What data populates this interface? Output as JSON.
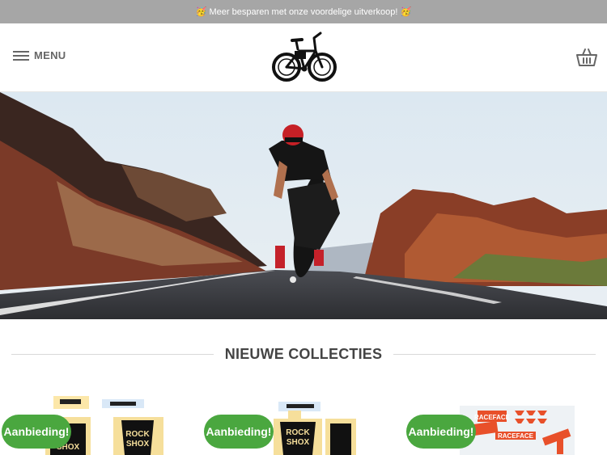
{
  "announcement": "🥳 Meer besparen met onze voordelige uitverkoop! 🥳",
  "header": {
    "menu_label": "MENU",
    "logo_icon": "bicycle-logo",
    "cart_icon": "basket-icon"
  },
  "hero": {
    "image": "road-cyclist-hero"
  },
  "collections": {
    "title": "NIEUWE COLLECTIES"
  },
  "products": [
    {
      "badge": "Aanbieding!",
      "image": "rockshox-decal-kit"
    },
    {
      "badge": "Aanbieding!",
      "image": "rockshox-decal-kit"
    },
    {
      "badge": "Aanbieding!",
      "image": "raceface-decal-kit"
    }
  ],
  "colors": {
    "topbar": "#a6a6a6",
    "badge": "#4aa73f",
    "title": "#444444"
  }
}
